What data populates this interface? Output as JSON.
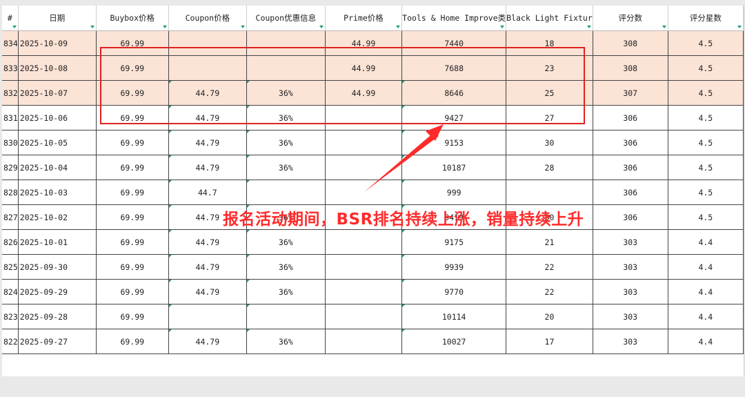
{
  "columns": [
    "#",
    "日期",
    "Buybox价格",
    "Coupon价格",
    "Coupon优惠信息",
    "Prime价格",
    "Tools & Home Improve类",
    "Black Light Fixtur",
    "评分数",
    "评分星数"
  ],
  "rows": [
    {
      "idx": "834",
      "date": "2025-10-09",
      "buybox": "69.99",
      "coupon_price": "",
      "coupon_info": "",
      "prime": "44.99",
      "bsr_main": "7440",
      "bsr_sub": "18",
      "ratings": "308",
      "stars": "4.5"
    },
    {
      "idx": "833",
      "date": "2025-10-08",
      "buybox": "69.99",
      "coupon_price": "",
      "coupon_info": "",
      "prime": "44.99",
      "bsr_main": "7688",
      "bsr_sub": "23",
      "ratings": "308",
      "stars": "4.5"
    },
    {
      "idx": "832",
      "date": "2025-10-07",
      "buybox": "69.99",
      "coupon_price": "44.79",
      "coupon_info": "36%",
      "prime": "44.99",
      "bsr_main": "8646",
      "bsr_sub": "25",
      "ratings": "307",
      "stars": "4.5"
    },
    {
      "idx": "831",
      "date": "2025-10-06",
      "buybox": "69.99",
      "coupon_price": "44.79",
      "coupon_info": "36%",
      "prime": "",
      "bsr_main": "9427",
      "bsr_sub": "27",
      "ratings": "306",
      "stars": "4.5"
    },
    {
      "idx": "830",
      "date": "2025-10-05",
      "buybox": "69.99",
      "coupon_price": "44.79",
      "coupon_info": "36%",
      "prime": "",
      "bsr_main": "9153",
      "bsr_sub": "30",
      "ratings": "306",
      "stars": "4.5"
    },
    {
      "idx": "829",
      "date": "2025-10-04",
      "buybox": "69.99",
      "coupon_price": "44.79",
      "coupon_info": "36%",
      "prime": "",
      "bsr_main": "10187",
      "bsr_sub": "28",
      "ratings": "306",
      "stars": "4.5"
    },
    {
      "idx": "828",
      "date": "2025-10-03",
      "buybox": "69.99",
      "coupon_price": "44.7",
      "coupon_info": "",
      "prime": "",
      "bsr_main": "999",
      "bsr_sub": "",
      "ratings": "306",
      "stars": "4.5"
    },
    {
      "idx": "827",
      "date": "2025-10-02",
      "buybox": "69.99",
      "coupon_price": "44.79",
      "coupon_info": "36%",
      "prime": "",
      "bsr_main": "9419",
      "bsr_sub": "30",
      "ratings": "306",
      "stars": "4.5"
    },
    {
      "idx": "826",
      "date": "2025-10-01",
      "buybox": "69.99",
      "coupon_price": "44.79",
      "coupon_info": "36%",
      "prime": "",
      "bsr_main": "9175",
      "bsr_sub": "21",
      "ratings": "303",
      "stars": "4.4"
    },
    {
      "idx": "825",
      "date": "2025-09-30",
      "buybox": "69.99",
      "coupon_price": "44.79",
      "coupon_info": "36%",
      "prime": "",
      "bsr_main": "9939",
      "bsr_sub": "22",
      "ratings": "303",
      "stars": "4.4"
    },
    {
      "idx": "824",
      "date": "2025-09-29",
      "buybox": "69.99",
      "coupon_price": "44.79",
      "coupon_info": "36%",
      "prime": "",
      "bsr_main": "9770",
      "bsr_sub": "22",
      "ratings": "303",
      "stars": "4.4"
    },
    {
      "idx": "823",
      "date": "2025-09-28",
      "buybox": "69.99",
      "coupon_price": "",
      "coupon_info": "",
      "prime": "",
      "bsr_main": "10114",
      "bsr_sub": "20",
      "ratings": "303",
      "stars": "4.4"
    },
    {
      "idx": "822",
      "date": "2025-09-27",
      "buybox": "69.99",
      "coupon_price": "44.79",
      "coupon_info": "36%",
      "prime": "",
      "bsr_main": "10027",
      "bsr_sub": "17",
      "ratings": "303",
      "stars": "4.4"
    }
  ],
  "highlighted_rows": 3,
  "annotation": "报名活动期间，BSR排名持续上涨，销量持续上升",
  "colors": {
    "highlight_fill": "#fbe3d6",
    "annotation_red": "#ff2b2b",
    "filter_green": "#1e9b76"
  }
}
